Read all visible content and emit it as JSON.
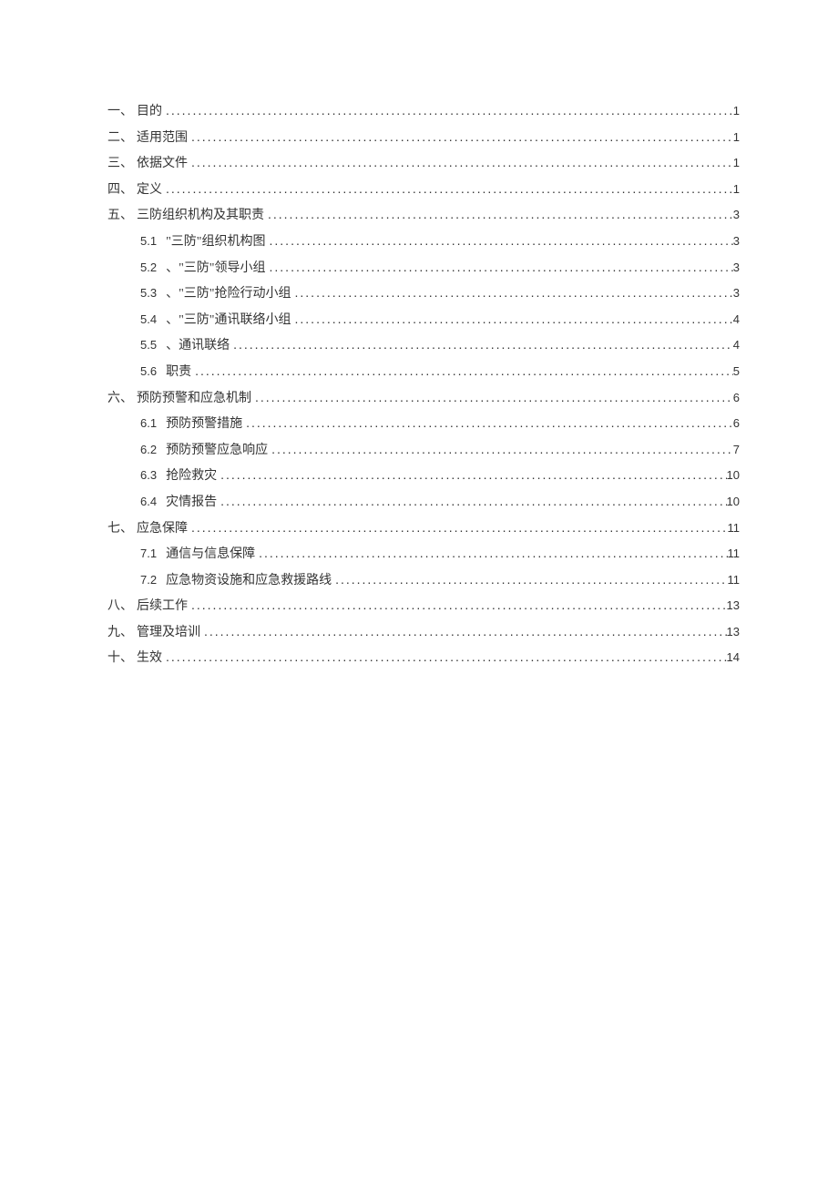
{
  "toc": [
    {
      "level": 1,
      "prefix": "一、",
      "num": "",
      "text": "目的",
      "page": "1"
    },
    {
      "level": 1,
      "prefix": "二、",
      "num": "",
      "text": "适用范围",
      "page": "1"
    },
    {
      "level": 1,
      "prefix": "三、",
      "num": "",
      "text": "依据文件",
      "page": "1"
    },
    {
      "level": 1,
      "prefix": "四、",
      "num": "",
      "text": "定义",
      "page": "1"
    },
    {
      "level": 1,
      "prefix": "五、",
      "num": "",
      "text": "三防组织机构及其职责",
      "page": "3"
    },
    {
      "level": 2,
      "prefix": "",
      "num": "5.1",
      "text": "\"三防\"组织机构图",
      "page": "3"
    },
    {
      "level": 2,
      "prefix": "",
      "num": "5.2",
      "text": "、\"三防\"领导小组",
      "page": "3"
    },
    {
      "level": 2,
      "prefix": "",
      "num": "5.3",
      "text": "、\"三防\"抢险行动小组",
      "page": "3"
    },
    {
      "level": 2,
      "prefix": "",
      "num": "5.4",
      "text": "、\"三防\"通讯联络小组",
      "page": "4"
    },
    {
      "level": 2,
      "prefix": "",
      "num": "5.5",
      "text": "、通讯联络",
      "page": "4"
    },
    {
      "level": 2,
      "prefix": "",
      "num": "5.6",
      "text": "职责",
      "page": "5"
    },
    {
      "level": 1,
      "prefix": "六、",
      "num": "",
      "text": "预防预警和应急机制",
      "page": "6"
    },
    {
      "level": 2,
      "prefix": "",
      "num": "6.1",
      "text": "预防预警措施",
      "page": "6"
    },
    {
      "level": 2,
      "prefix": "",
      "num": "6.2",
      "text": "预防预警应急响应",
      "page": "7"
    },
    {
      "level": 2,
      "prefix": "",
      "num": "6.3",
      "text": "抢险救灾",
      "page": "10"
    },
    {
      "level": 2,
      "prefix": "",
      "num": "6.4",
      "text": "灾情报告",
      "page": "10"
    },
    {
      "level": 1,
      "prefix": "七、",
      "num": "",
      "text": "应急保障",
      "page": "11"
    },
    {
      "level": 2,
      "prefix": "",
      "num": "7.1",
      "text": "通信与信息保障",
      "page": "11"
    },
    {
      "level": 2,
      "prefix": "",
      "num": "7.2",
      "text": "应急物资设施和应急救援路线",
      "page": "11"
    },
    {
      "level": 1,
      "prefix": "八、",
      "num": "",
      "text": "后续工作",
      "page": "13"
    },
    {
      "level": 1,
      "prefix": "九、",
      "num": "",
      "text": "管理及培训",
      "page": "13"
    },
    {
      "level": 1,
      "prefix": "十、",
      "num": "",
      "text": "生效",
      "page": "14"
    }
  ]
}
